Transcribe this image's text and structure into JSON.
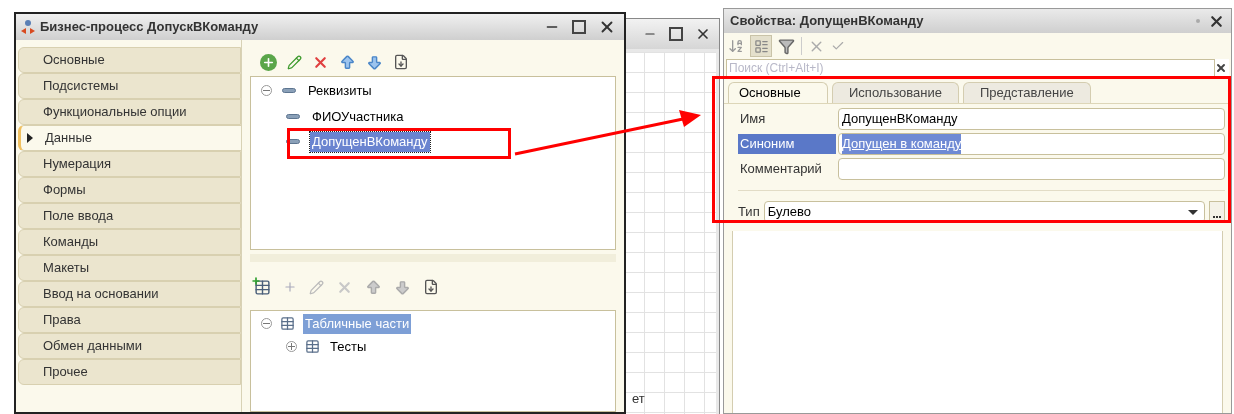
{
  "main_window": {
    "title": "Бизнес-процесс ДопускВКоманду",
    "sections": [
      {
        "label": "Основные",
        "selected": false
      },
      {
        "label": "Подсистемы",
        "selected": false
      },
      {
        "label": "Функциональные опции",
        "selected": false
      },
      {
        "label": "Данные",
        "selected": true
      },
      {
        "label": "Нумерация",
        "selected": false
      },
      {
        "label": "Формы",
        "selected": false
      },
      {
        "label": "Поле ввода",
        "selected": false
      },
      {
        "label": "Команды",
        "selected": false
      },
      {
        "label": "Макеты",
        "selected": false
      },
      {
        "label": "Ввод на основании",
        "selected": false
      },
      {
        "label": "Права",
        "selected": false
      },
      {
        "label": "Обмен данными",
        "selected": false
      },
      {
        "label": "Прочее",
        "selected": false
      }
    ],
    "attributes_tree": {
      "label": "Реквизиты",
      "expanded": true,
      "selected": false,
      "children": [
        {
          "label": "ФИОУчастника",
          "selected": false
        },
        {
          "label": "ДопущенВКоманду",
          "selected": true
        }
      ]
    },
    "tabular_tree": {
      "label": "Табличные части",
      "expanded": true,
      "selected": true,
      "children": [
        {
          "label": "Тесты",
          "expanded": false,
          "selected": false
        }
      ]
    }
  },
  "background_window": {
    "fragment": "ет"
  },
  "properties": {
    "title": "Свойства: ДопущенВКоманду",
    "search": {
      "placeholder": "Поиск (Ctrl+Alt+I)"
    },
    "tabs": [
      {
        "label": "Основные",
        "selected": true
      },
      {
        "label": "Использование",
        "selected": false
      },
      {
        "label": "Представление",
        "selected": false
      }
    ],
    "fields": [
      {
        "label": "Имя",
        "value": "ДопущенВКоманду",
        "selected": false
      },
      {
        "label": "Синоним",
        "value": "Допущен в команду",
        "selected": true
      },
      {
        "label": "Комментарий",
        "selected": false
      }
    ],
    "type_field": {
      "label": "Тип",
      "value": "Булево"
    }
  }
}
